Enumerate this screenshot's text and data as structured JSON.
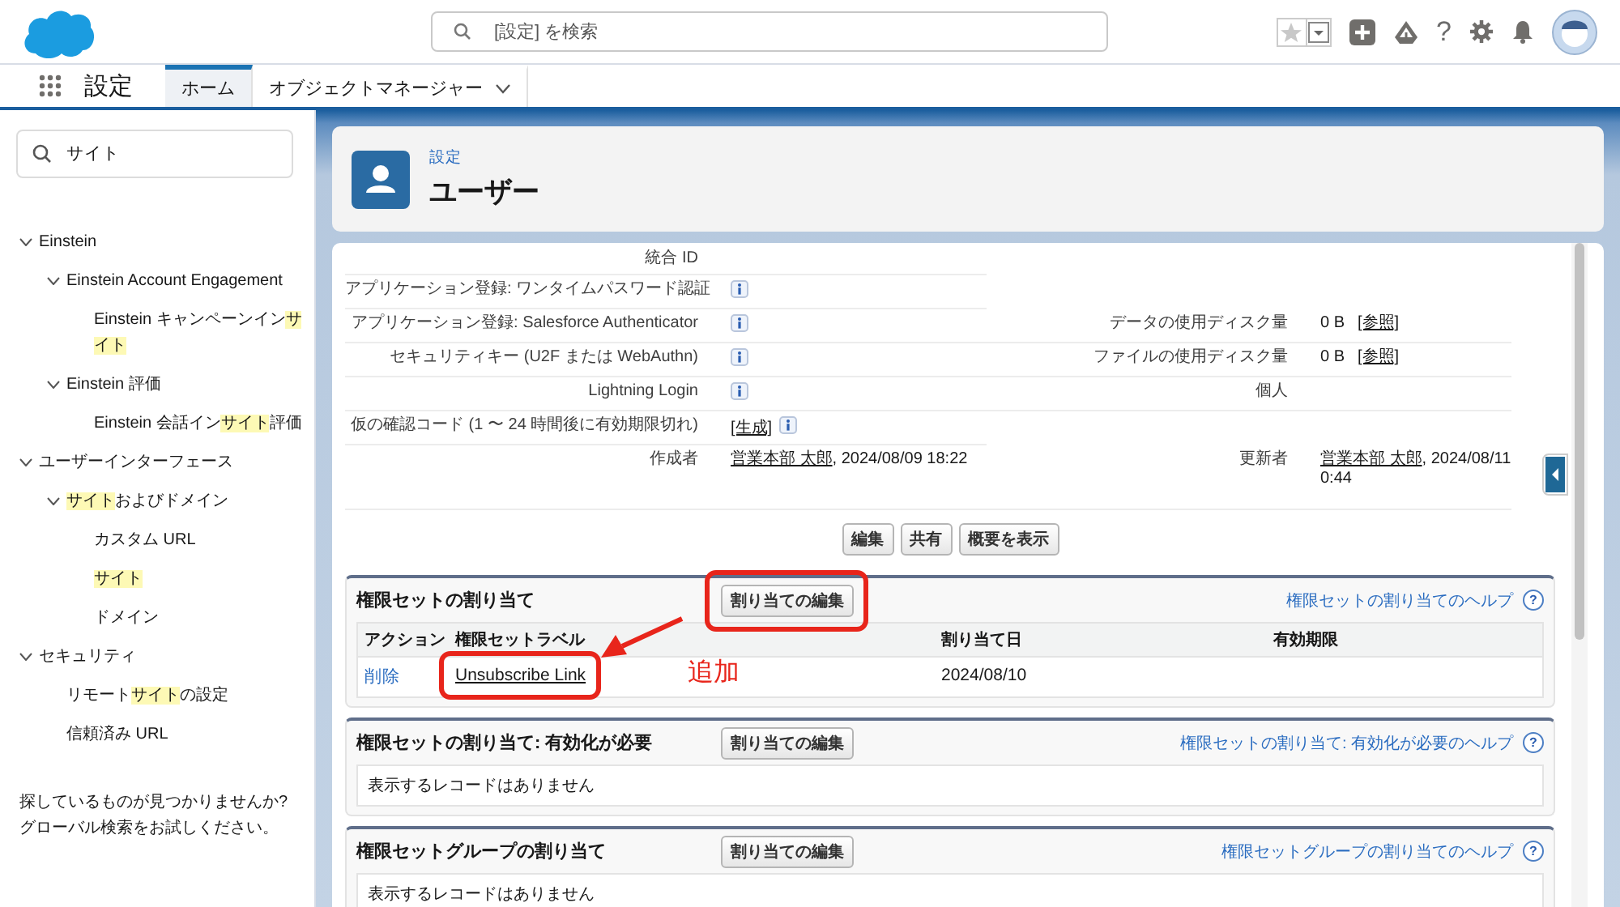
{
  "header": {
    "search": {
      "placeholder": "[設定] を検索"
    },
    "help_glyph": "?"
  },
  "nav": {
    "app_title": "設定",
    "tabs": [
      {
        "label": "ホーム",
        "selected": true,
        "has_menu": false
      },
      {
        "label": "オブジェクトマネージャー",
        "selected": false,
        "has_menu": true
      }
    ]
  },
  "sidebar": {
    "search": {
      "value": "サイト"
    },
    "tree": [
      {
        "segments": [
          {
            "text": "Einstein",
            "match": false
          }
        ],
        "expanded": true,
        "children": [
          {
            "segments": [
              {
                "text": "Einstein Account Engagement",
                "match": false
              }
            ],
            "expanded": true,
            "children": [
              {
                "segments": [
                  {
                    "text": "Einstein キャンペーンイン",
                    "match": false
                  },
                  {
                    "text": "サイト",
                    "match": true
                  }
                ]
              }
            ]
          },
          {
            "segments": [
              {
                "text": "Einstein 評価",
                "match": false
              }
            ],
            "expanded": true,
            "children": [
              {
                "segments": [
                  {
                    "text": "Einstein 会話イン",
                    "match": false
                  },
                  {
                    "text": "サイト",
                    "match": true
                  },
                  {
                    "text": "評価",
                    "match": false
                  }
                ]
              }
            ]
          }
        ]
      },
      {
        "segments": [
          {
            "text": "ユーザーインターフェース",
            "match": false
          }
        ],
        "expanded": true,
        "children": [
          {
            "segments": [
              {
                "text": "サイト",
                "match": true
              },
              {
                "text": "およびドメイン",
                "match": false
              }
            ],
            "expanded": true,
            "children": [
              {
                "segments": [
                  {
                    "text": "カスタム URL",
                    "match": false
                  }
                ]
              },
              {
                "segments": [
                  {
                    "text": "サイト",
                    "match": true
                  }
                ]
              },
              {
                "segments": [
                  {
                    "text": "ドメイン",
                    "match": false
                  }
                ]
              }
            ]
          }
        ]
      },
      {
        "segments": [
          {
            "text": "セキュリティ",
            "match": false
          }
        ],
        "expanded": true,
        "children": [
          {
            "segments": [
              {
                "text": "リモート",
                "match": false
              },
              {
                "text": "サイト",
                "match": true
              },
              {
                "text": "の設定",
                "match": false
              }
            ]
          },
          {
            "segments": [
              {
                "text": "信頼済み URL",
                "match": false
              }
            ]
          }
        ]
      }
    ],
    "footer": "探しているものが見つかりませんか? グローバル検索をお試しください。"
  },
  "page_header": {
    "breadcrumb": "設定",
    "title": "ユーザー"
  },
  "details": {
    "rows": [
      {
        "left_label": "統合 ID"
      },
      {
        "left_label": "アプリケーション登録: ワンタイムパスワード認証",
        "left_value": {
          "kind": "info"
        }
      },
      {
        "left_label": "アプリケーション登録: Salesforce Authenticator",
        "left_value": {
          "kind": "info"
        },
        "right_label": "データの使用ディスク量",
        "right_value": {
          "kind": "size",
          "text": "0 B",
          "link": "[参照]"
        }
      },
      {
        "left_label": "セキュリティキー (U2F または WebAuthn)",
        "left_value": {
          "kind": "info"
        },
        "right_label": "ファイルの使用ディスク量",
        "right_value": {
          "kind": "size",
          "text": "0 B",
          "link": "[参照]"
        }
      },
      {
        "left_label": "Lightning Login",
        "left_value": {
          "kind": "info"
        },
        "right_label": "個人"
      },
      {
        "left_label": "仮の確認コード (1 〜 24 時間後に有効期限切れ)",
        "left_value": {
          "kind": "link_info",
          "link": "[生成]"
        }
      },
      {
        "left_label": "作成者",
        "left_value": {
          "kind": "user_date",
          "link": "営業本部 太郎",
          "text": ", 2024/08/09 18:22"
        },
        "right_label": "更新者",
        "right_value": {
          "kind": "user_date",
          "link": "営業本部 太郎",
          "text": ", 2024/08/11 0:44"
        }
      }
    ],
    "buttons": [
      "編集",
      "共有",
      "概要を表示"
    ]
  },
  "related_lists": [
    {
      "title": "権限セットの割り当て",
      "edit_button": {
        "label": "割り当ての編集",
        "annotated": true
      },
      "help_link": "権限セットの割り当てのヘルプ",
      "help_glyph": "?",
      "columns": [
        "アクション",
        "権限セットラベル",
        "割り当て日",
        "有効期限"
      ],
      "rows": [
        {
          "cells": [
            {
              "kind": "link",
              "text": "削除"
            },
            {
              "kind": "record_link",
              "text": "Unsubscribe Link",
              "annotated": true
            },
            {
              "kind": "text",
              "text": "2024/08/10"
            }
          ]
        }
      ]
    },
    {
      "title": "権限セットの割り当て: 有効化が必要",
      "edit_button": {
        "label": "割り当ての編集"
      },
      "help_link": "権限セットの割り当て: 有効化が必要のヘルプ",
      "help_glyph": "?",
      "empty_message": "表示するレコードはありません"
    },
    {
      "title": "権限セットグループの割り当て",
      "edit_button": {
        "label": "割り当ての編集"
      },
      "help_link": "権限セットグループの割り当てのヘルプ",
      "help_glyph": "?",
      "empty_message": "表示するレコードはありません"
    }
  ],
  "annotation": {
    "text": "追加"
  }
}
